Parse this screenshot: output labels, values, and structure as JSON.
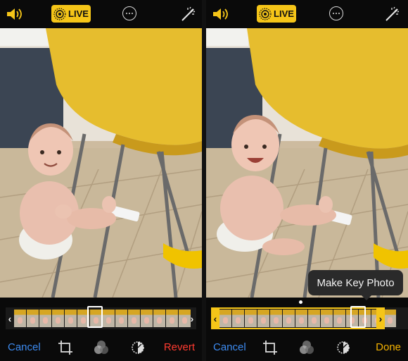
{
  "colors": {
    "accent_yellow": "#f5c518",
    "cancel_blue": "#3d8bf0",
    "revert_red": "#ff3b30",
    "done_yellow": "#f5b301",
    "background": "#0a0a0a"
  },
  "left_screen": {
    "topbar": {
      "speaker_icon": "speaker-volume-icon",
      "live_label": "LIVE",
      "live_icon": "live-photo-icon",
      "more_icon": "ellipsis-circle-icon",
      "auto_enhance_icon": "magic-wand-icon"
    },
    "scrubber": {
      "left_handle": "‹",
      "right_handle": "›"
    },
    "toolbar": {
      "cancel_label": "Cancel",
      "crop_icon": "crop-rotate-icon",
      "filters_icon": "filters-icon",
      "adjust_icon": "adjust-dial-icon",
      "revert_label": "Revert"
    }
  },
  "right_screen": {
    "topbar": {
      "speaker_icon": "speaker-volume-icon",
      "live_label": "LIVE",
      "live_icon": "live-photo-icon",
      "more_icon": "ellipsis-circle-icon",
      "auto_enhance_icon": "magic-wand-icon"
    },
    "tooltip": "Make Key Photo",
    "scrubber": {
      "left_handle": "‹",
      "right_handle": "›"
    },
    "toolbar": {
      "cancel_label": "Cancel",
      "crop_icon": "crop-rotate-icon",
      "filters_icon": "filters-icon",
      "adjust_icon": "adjust-dial-icon",
      "done_label": "Done"
    }
  }
}
